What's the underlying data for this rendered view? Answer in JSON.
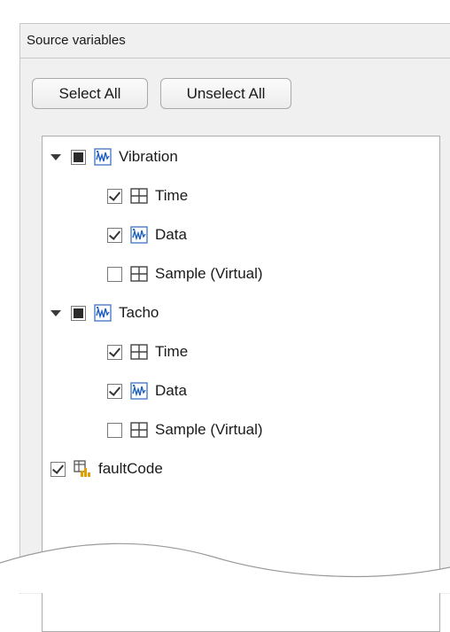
{
  "panel": {
    "title": "Source variables",
    "select_all_label": "Select All",
    "unselect_all_label": "Unselect All"
  },
  "tree": [
    {
      "label": "Vibration",
      "type": "timetable",
      "state": "mixed",
      "expanded": true,
      "children": [
        {
          "label": "Time",
          "type": "column",
          "state": "checked"
        },
        {
          "label": "Data",
          "type": "timetable",
          "state": "checked"
        },
        {
          "label": "Sample (Virtual)",
          "type": "column",
          "state": "unchecked"
        }
      ]
    },
    {
      "label": "Tacho",
      "type": "timetable",
      "state": "mixed",
      "expanded": true,
      "children": [
        {
          "label": "Time",
          "type": "column",
          "state": "checked"
        },
        {
          "label": "Data",
          "type": "timetable",
          "state": "checked"
        },
        {
          "label": "Sample (Virtual)",
          "type": "column",
          "state": "unchecked"
        }
      ]
    },
    {
      "label": "faultCode",
      "type": "variable",
      "state": "checked"
    }
  ],
  "colors": {
    "panel_bg": "#f0f0f0",
    "border": "#adadad",
    "icon_blue": "#1f5fbf",
    "icon_orange": "#e0a000"
  }
}
